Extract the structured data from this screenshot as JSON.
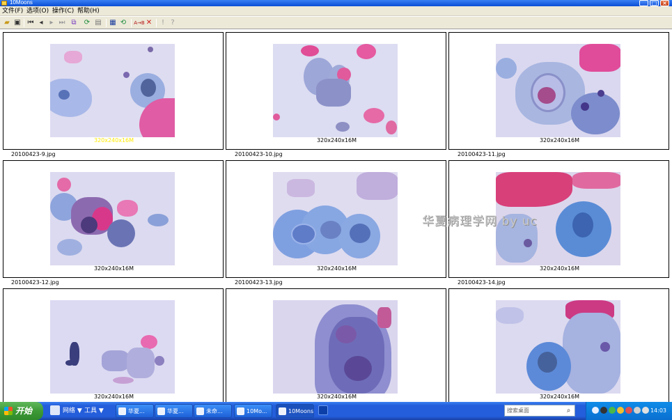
{
  "window": {
    "title": "10Moons"
  },
  "menu": [
    {
      "label": "文件(F)"
    },
    {
      "label": "选项(O)"
    },
    {
      "label": "操作(C)"
    },
    {
      "label": "帮助(H)"
    }
  ],
  "toolbar": {
    "icons": [
      "open-folder-icon",
      "save-icon",
      "first-icon",
      "prev-icon",
      "next-icon",
      "last-icon",
      "copy-icon",
      "refresh-icon",
      "scan-icon",
      "slideshow-icon",
      "convert-icon",
      "rename-icon",
      "delete-icon",
      "info-icon",
      "help-icon"
    ]
  },
  "thumbnails": [
    {
      "file": "20100423-9.jpg",
      "dim": "320x240x16M",
      "highlight": true
    },
    {
      "file": "20100423-10.jpg",
      "dim": "320x240x16M",
      "highlight": false
    },
    {
      "file": "20100423-11.jpg",
      "dim": "320x240x16M",
      "highlight": false
    },
    {
      "file": "20100423-12.jpg",
      "dim": "320x240x16M",
      "highlight": false
    },
    {
      "file": "20100423-13.jpg",
      "dim": "320x240x16M",
      "highlight": false
    },
    {
      "file": "20100423-14.jpg",
      "dim": "320x240x16M",
      "highlight": false
    },
    {
      "file": "",
      "dim": "320x240x16M",
      "highlight": false
    },
    {
      "file": "",
      "dim": "320x240x16M",
      "highlight": false
    },
    {
      "file": "",
      "dim": "320x240x16M",
      "highlight": false
    }
  ],
  "watermark": "华夏病理学网 by uc",
  "taskbar": {
    "start_label": "开始",
    "menus": [
      {
        "label": "网络 ▼"
      },
      {
        "label": "工具 ▼"
      }
    ],
    "tasks": [
      {
        "label": "华夏..."
      },
      {
        "label": "华夏..."
      },
      {
        "label": "未命..."
      },
      {
        "label": "10Mo..."
      },
      {
        "label": "10Moons"
      }
    ],
    "search_placeholder": "搜索桌面",
    "clock": "14:03"
  },
  "colors": {
    "stain_pink": "#e0468c",
    "stain_blue": "#5a8fd6",
    "stain_purple": "#6a4a9c",
    "background_field": "#dcdcf0"
  }
}
